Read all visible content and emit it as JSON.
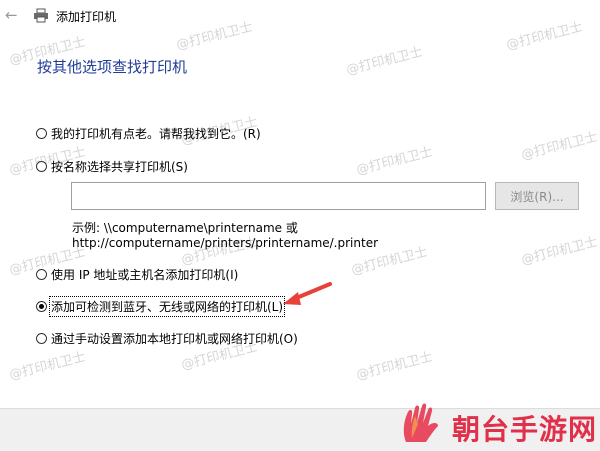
{
  "window": {
    "title": "添加打印机"
  },
  "heading": "按其他选项查找打印机",
  "options": [
    {
      "label": "我的打印机有点老。请帮我找到它。(R)",
      "selected": false
    },
    {
      "label": "按名称选择共享打印机(S)",
      "selected": false
    },
    {
      "label": "使用 IP 地址或主机名添加打印机(I)",
      "selected": false
    },
    {
      "label": "添加可检测到蓝牙、无线或网络的打印机(L)",
      "selected": true
    },
    {
      "label": "通过手动设置添加本地打印机或网络打印机(O)",
      "selected": false
    }
  ],
  "share_input": {
    "value": "",
    "browse_label": "浏览(R)..."
  },
  "example": {
    "line1": "示例: \\\\computername\\printername 或",
    "line2": "http://computername/printers/printername/.printer"
  },
  "watermark": "@打印机卫士",
  "brand": {
    "name": "朝台手游网",
    "color": "#e0304a"
  },
  "icons": {
    "back": "back-arrow-icon",
    "printer": "printer-icon",
    "annotation": "red-arrow-icon"
  }
}
